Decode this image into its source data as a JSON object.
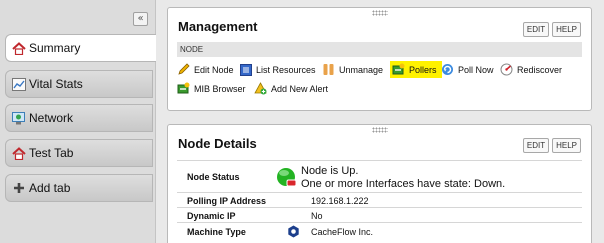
{
  "sidebar": {
    "collapse_label": "«",
    "tabs": [
      {
        "label": "Summary",
        "icon": "home-icon",
        "active": true
      },
      {
        "label": "Vital Stats",
        "icon": "chart-icon",
        "active": false
      },
      {
        "label": "Network",
        "icon": "network-icon",
        "active": false
      },
      {
        "label": "Test Tab",
        "icon": "home-icon",
        "active": false
      },
      {
        "label": "Add tab",
        "icon": "plus-icon",
        "active": false
      }
    ]
  },
  "management": {
    "title": "Management",
    "edit_label": "EDIT",
    "help_label": "HELP",
    "section_label": "NODE",
    "actions": [
      {
        "label": "Edit Node",
        "icon": "pencil-icon"
      },
      {
        "label": "List Resources",
        "icon": "list-icon"
      },
      {
        "label": "Unmanage",
        "icon": "pause-icon"
      },
      {
        "label": "Pollers",
        "icon": "poller-icon"
      },
      {
        "label": "Poll Now",
        "icon": "refresh-icon"
      },
      {
        "label": "Rediscover",
        "icon": "rediscover-icon"
      },
      {
        "label": "MIB Browser",
        "icon": "mib-icon"
      },
      {
        "label": "Add New Alert",
        "icon": "alert-icon"
      }
    ]
  },
  "details": {
    "title": "Node Details",
    "edit_label": "EDIT",
    "help_label": "HELP",
    "rows": [
      {
        "label": "Node Status",
        "line1": "Node is Up.",
        "line2": "One or more Interfaces have state: Down."
      },
      {
        "label": "Polling IP Address",
        "value": "192.168.1.222"
      },
      {
        "label": "Dynamic IP",
        "value": "No"
      },
      {
        "label": "Machine Type",
        "value": "CacheFlow Inc."
      }
    ]
  },
  "colors": {
    "highlight": "#fff200",
    "status_up": "#22b522",
    "status_warn": "#d9262c"
  }
}
